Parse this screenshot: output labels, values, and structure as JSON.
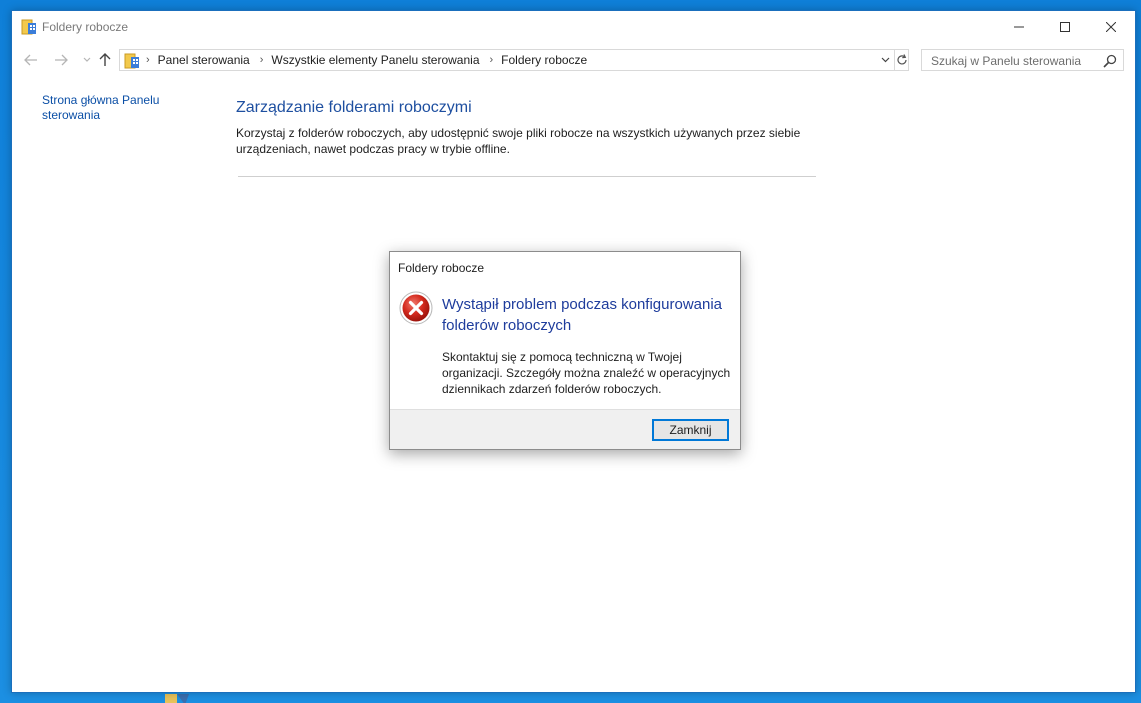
{
  "window": {
    "title": "Foldery robocze",
    "controls": {
      "minimize": "minimize",
      "maximize": "maximize",
      "close": "close"
    }
  },
  "address_bar": {
    "breadcrumbs": [
      {
        "label": "Panel sterowania"
      },
      {
        "label": "Wszystkie elementy Panelu sterowania"
      },
      {
        "label": "Foldery robocze"
      }
    ]
  },
  "search": {
    "placeholder": "Szukaj w Panelu sterowania"
  },
  "sidebar": {
    "home_link": "Strona główna Panelu sterowania"
  },
  "main": {
    "title": "Zarządzanie folderami roboczymi",
    "description": "Korzystaj z folderów roboczych, aby udostępnić swoje pliki robocze na wszystkich używanych przez siebie urządzeniach, nawet podczas pracy w trybie offline."
  },
  "dialog": {
    "title": "Foldery robocze",
    "heading": "Wystąpił problem podczas konfigurowania folderów roboczych",
    "body": "Skontaktuj się z pomocą techniczną w Twojej organizacji. Szczegóły można znaleźć w operacyjnych dziennikach zdarzeń folderów roboczych.",
    "close_button": "Zamknij",
    "icon": "error-icon"
  },
  "colors": {
    "desktop": "#1a86d9",
    "link": "#0b4fa6",
    "heading": "#1e4fa0",
    "error_red": "#c42b1c",
    "accent": "#0078d7"
  }
}
